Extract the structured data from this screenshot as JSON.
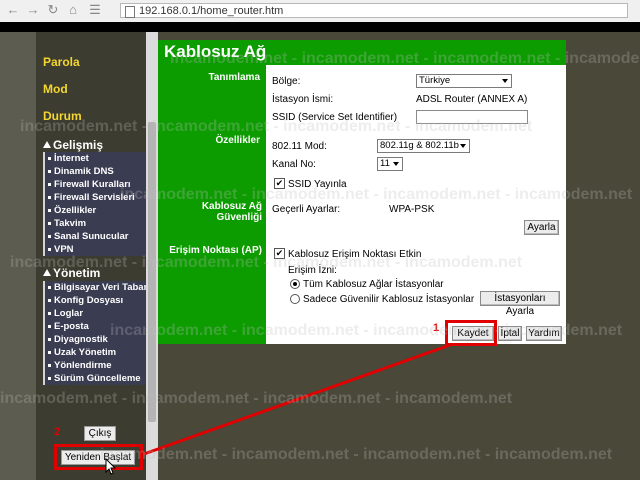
{
  "browser": {
    "url": "192.168.0.1/home_router.htm"
  },
  "sidebar": {
    "top_items": [
      "Parola",
      "Mod",
      "Durum"
    ],
    "gelismis": {
      "title": "Gelişmiş",
      "items": [
        "İnternet",
        "Dinamik DNS",
        "Firewall Kuralları",
        "Firewall Servisleri",
        "Özellikler",
        "Takvim",
        "Sanal Sunucular",
        "VPN"
      ]
    },
    "yonetim": {
      "title": "Yönetim",
      "items": [
        "Bilgisayar Veri Tabanı",
        "Konfig Dosyası",
        "Loglar",
        "E-posta",
        "Diyagnostik",
        "Uzak Yönetim",
        "Yönlendirme",
        "Sürüm Güncelleme"
      ]
    },
    "logout_label": "Çıkış",
    "restart_label": "Yeniden Başlat",
    "restart_annotation": "2"
  },
  "page": {
    "title": "Kablosuz Ağ",
    "sections": {
      "tanimlama": "Tanımlama",
      "ozellikler": "Özellikler",
      "guvenlik": "Kablosuz Ağ Güvenliği",
      "erisim": "Erişim Noktası (AP)"
    },
    "region_label": "Bölge:",
    "region_value": "Türkiye",
    "station_name_label": "İstasyon İsmi:",
    "station_name_value": "ADSL Router (ANNEX A)",
    "ssid_label": "SSID (Service Set Identifier)",
    "ssid_value": "",
    "mode_label": "802.11 Mod:",
    "mode_value": "802.11g & 802.11b",
    "channel_label": "Kanal No:",
    "channel_value": "11",
    "ssid_broadcast_label": "SSID Yayınla",
    "current_settings_label": "Geçerli Ayarlar:",
    "current_settings_value": "WPA-PSK",
    "configure_button": "Ayarla",
    "ap_enabled_label": "Kablosuz Erişim Noktası Etkin",
    "access_permission_label": "Erişim İzni:",
    "radio_all": "Tüm Kablosuz Ağlar İstasyonlar",
    "radio_trusted": "Sadece Güvenilir Kablosuz İstasyonlar",
    "stations_button": "İstasyonları Ayarla",
    "save_button": "Kaydet",
    "cancel_button": "İptal",
    "help_button": "Yardım",
    "save_annotation": "1"
  },
  "watermark": "incamodem.net - incamodem.net - incamodem.net - incamodem.net",
  "colors": {
    "accent_green": "#0c9c00",
    "highlight_red": "#e00000",
    "sidebar_yellow": "#f3d631"
  }
}
